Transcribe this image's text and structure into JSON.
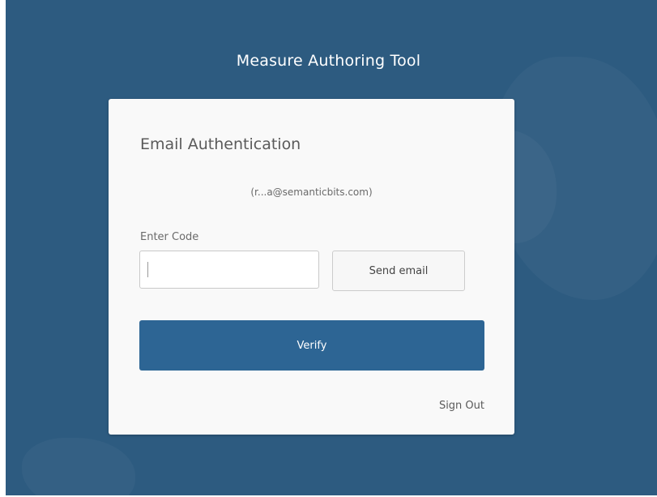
{
  "app": {
    "title": "Measure Authoring Tool"
  },
  "card": {
    "title": "Email Authentication",
    "masked_email": "(r...a@semanticbits.com)",
    "code_label": "Enter Code",
    "code_value": "",
    "send_label": "Send email",
    "verify_label": "Verify",
    "signout_label": "Sign Out"
  },
  "colors": {
    "background": "#2d5b80",
    "card": "#f9f9f9",
    "primary_button": "#2d6594"
  }
}
